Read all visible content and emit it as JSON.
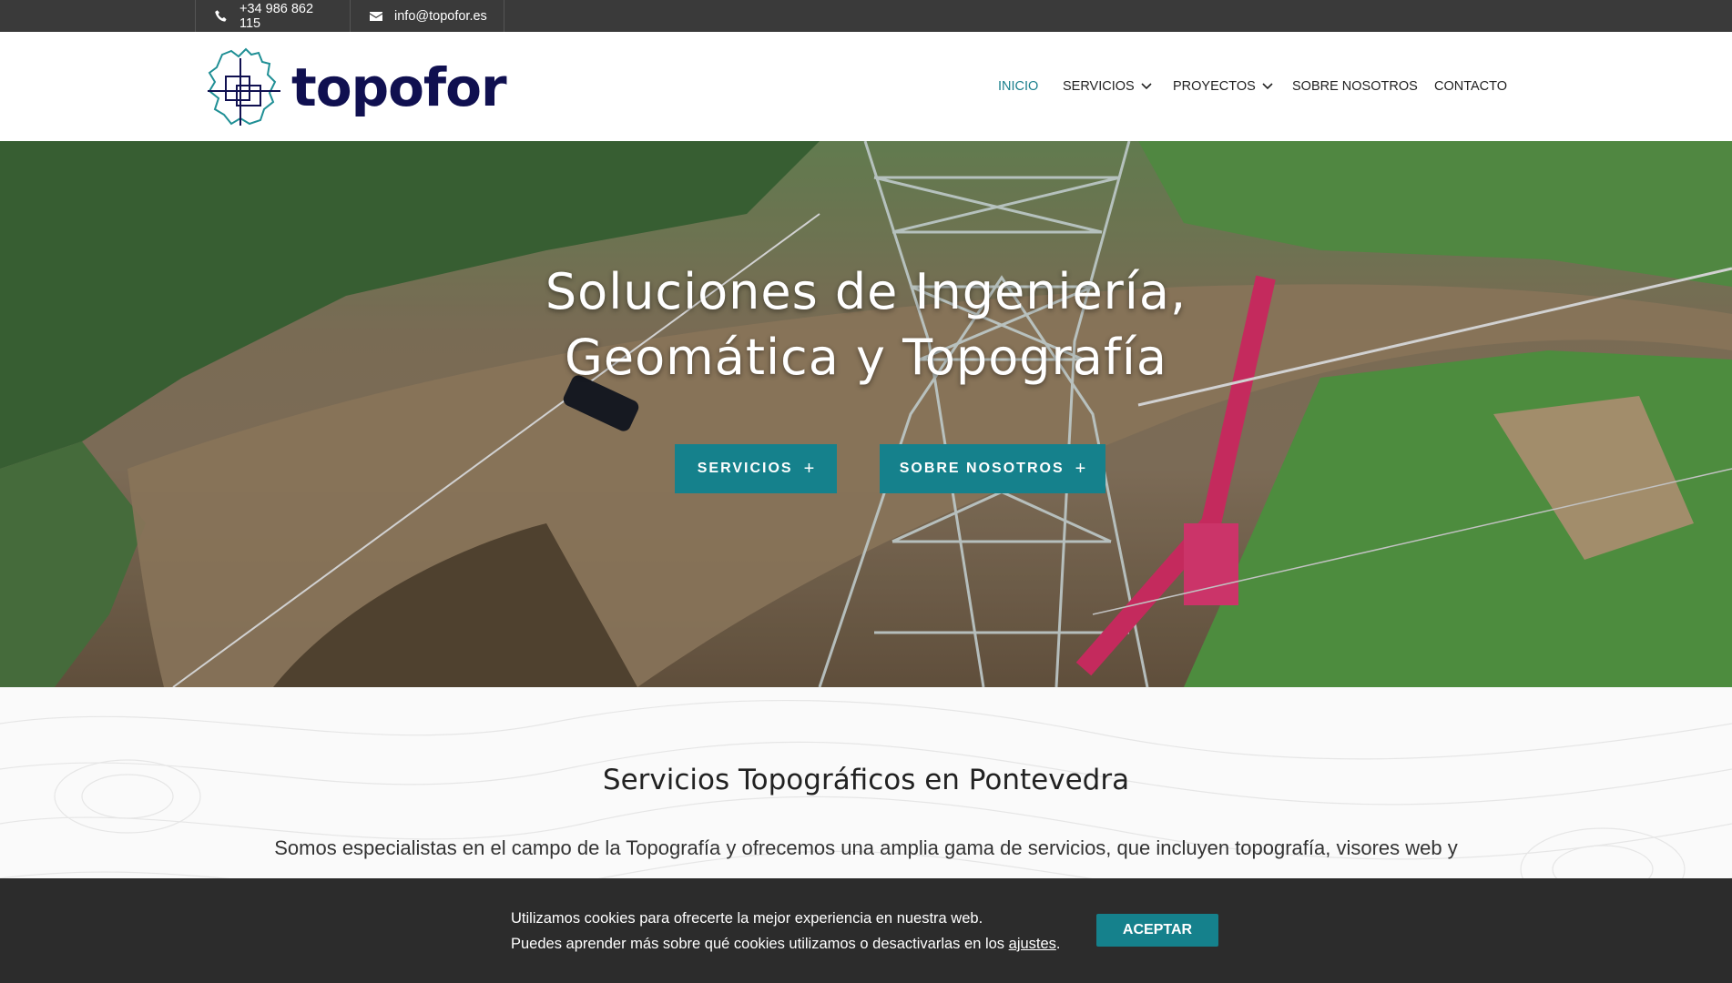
{
  "topbar": {
    "phone": "+34 986 862 115",
    "email": "info@topofor.es",
    "phone_icon": "phone-icon",
    "email_icon": "envelope-icon"
  },
  "logo": {
    "text": "topofor"
  },
  "nav": {
    "items": [
      {
        "label": "INICIO",
        "active": true
      },
      {
        "label": "SERVICIOS",
        "dropdown": true
      },
      {
        "label": "PROYECTOS",
        "dropdown": true
      },
      {
        "label": "SOBRE NOSOTROS"
      },
      {
        "label": "CONTACTO"
      }
    ]
  },
  "hero": {
    "title_line1": "Soluciones de Ingeniería,",
    "title_line2": "Geomática y Topografía",
    "button_services": "SERVICIOS",
    "button_about": "SOBRE NOSOTROS",
    "button_icon": "plus-icon"
  },
  "intro": {
    "heading": "Servicios Topográficos en Pontevedra",
    "paragraph": "Somos especialistas en el campo de la Topografía y ofrecemos una amplia gama de servicios, que incluyen topografía, visores web y"
  },
  "cookie": {
    "line1": "Utilizamos cookies para ofrecerte la mejor experiencia en nuestra web.",
    "line2_prefix": "Puedes aprender más sobre qué cookies utilizamos o desactivarlas en los ",
    "line2_link": "ajustes",
    "line2_suffix": ".",
    "accept": "ACEPTAR"
  },
  "colors": {
    "accent": "#15818c",
    "topbar_bg": "#3a3a3a",
    "cookie_bg": "#2c2c2c",
    "logo_text": "#101050"
  }
}
